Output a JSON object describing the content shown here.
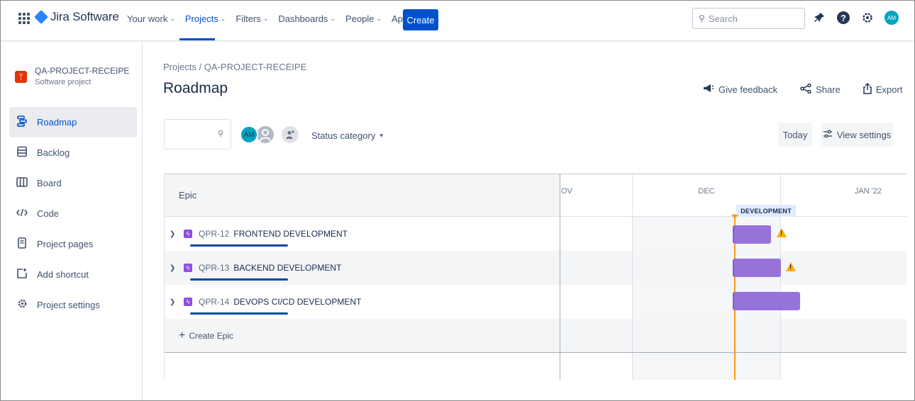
{
  "app": {
    "name": "Jira Software"
  },
  "nav": {
    "items": [
      {
        "label": "Your work",
        "chevron": "⌄"
      },
      {
        "label": "Projects",
        "chevron": "⌄"
      },
      {
        "label": "Filters",
        "chevron": "⌄"
      },
      {
        "label": "Dashboards",
        "chevron": "⌄"
      },
      {
        "label": "People",
        "chevron": "⌄"
      },
      {
        "label": "Apps",
        "chevron": "⌄"
      }
    ],
    "active": "Projects",
    "create_label": "Create",
    "search_placeholder": "Search",
    "avatar_initials": "AM"
  },
  "project": {
    "name": "QA-PROJECT-RECEIPE",
    "type": "Software project"
  },
  "sidebar": {
    "items": [
      {
        "label": "Roadmap",
        "icon": "roadmap-icon",
        "active": true
      },
      {
        "label": "Backlog",
        "icon": "backlog-icon",
        "active": false
      },
      {
        "label": "Board",
        "icon": "board-icon",
        "active": false
      },
      {
        "label": "Code",
        "icon": "code-icon",
        "active": false
      },
      {
        "label": "Project pages",
        "icon": "pages-icon",
        "active": false
      },
      {
        "label": "Add shortcut",
        "icon": "add-shortcut-icon",
        "active": false
      },
      {
        "label": "Project settings",
        "icon": "settings-icon",
        "active": false
      }
    ]
  },
  "main": {
    "breadcrumb": "Projects  /  QA-PROJECT-RECEIPE",
    "title": "Roadmap",
    "actions": {
      "feedback": "Give feedback",
      "share": "Share",
      "export": "Export"
    },
    "filters": {
      "avatar_initials": "AM",
      "status_category": "Status category"
    },
    "today_label": "Today",
    "view_settings_label": "View settings"
  },
  "roadmap": {
    "epic_header": "Epic",
    "months": [
      "OV",
      "DEC",
      "JAN '22"
    ],
    "release_label": "DEVELOPMENT",
    "epics": [
      {
        "key": "QPR-12",
        "name": "FRONTEND DEVELOPMENT",
        "warning": true
      },
      {
        "key": "QPR-13",
        "name": "BACKEND DEVELOPMENT",
        "warning": true
      },
      {
        "key": "QPR-14",
        "name": "DEVOPS CI/CD DEVELOPMENT",
        "warning": false
      }
    ],
    "create_epic_label": "Create Epic"
  },
  "colors": {
    "brand": "#0052cc",
    "epic": "#904ee2",
    "bar": "#9773d9",
    "today": "#ff991f",
    "warning": "#ffab00"
  }
}
